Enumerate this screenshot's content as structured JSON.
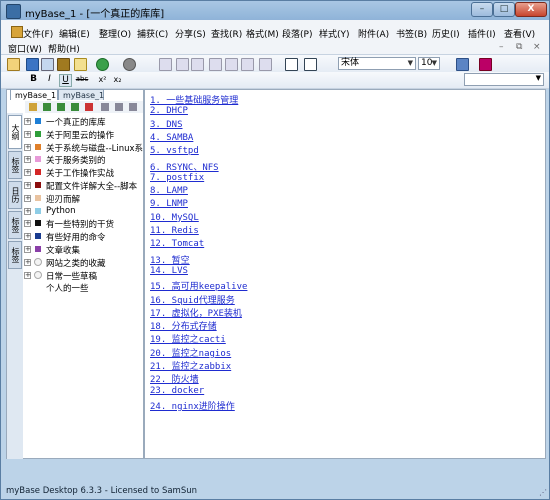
{
  "window": {
    "title": "myBase_1 - [一个真正的库库]"
  },
  "window_controls": {
    "min": "–",
    "max": "□",
    "close": "X"
  },
  "menubar": {
    "row1": [
      "文件(F)",
      "编辑(E)",
      "整理(O)",
      "捕获(C)",
      "分享(S)",
      "查找(R)",
      "格式(M)",
      "段落(P)",
      "样式(Y)",
      "附件(A)",
      "书签(B)",
      "历史(I)",
      "插件(I)",
      "查看(V)"
    ],
    "row2": [
      "窗口(W)",
      "帮助(H)"
    ],
    "mdi_controls": {
      "min": "–",
      "restore": "⧉",
      "close": "×"
    }
  },
  "toolbar": {
    "font_name": "宋体",
    "font_size": "10",
    "format_buttons": {
      "bold": "B",
      "italic": "I",
      "underline": "U",
      "strike": "abc",
      "superscript": "x²",
      "subscript": "x₂"
    }
  },
  "search": {
    "value": ""
  },
  "left_panel": {
    "tabs": [
      "myBase_1",
      "myBase_1"
    ],
    "side_tabs": [
      "大纲",
      "标签",
      "日历",
      "标签",
      "标签"
    ],
    "tree": [
      {
        "label": "一个真正的库库",
        "color": "#1e7fd6",
        "expand": "+",
        "kind": "square"
      },
      {
        "label": "关于阿里云的操作",
        "color": "#2e9e3a",
        "expand": "+",
        "kind": "square"
      },
      {
        "label": "关于系统与磁盘--Linux系",
        "color": "#e0802a",
        "expand": "+",
        "kind": "square"
      },
      {
        "label": "关于服务类别的",
        "color": "#e79ad8",
        "expand": "+",
        "kind": "square"
      },
      {
        "label": "关于工作操作实战",
        "color": "#d42626",
        "expand": "+",
        "kind": "square"
      },
      {
        "label": "配置文件详解大全--脚本",
        "color": "#8b0d0d",
        "expand": "+",
        "kind": "square"
      },
      {
        "label": "迎刃而解",
        "color": "#e9c3a0",
        "expand": "+",
        "kind": "square"
      },
      {
        "label": "Python",
        "color": "#8ecde6",
        "expand": "+",
        "kind": "square"
      },
      {
        "label": "有一些特别的干货",
        "color": "#101010",
        "expand": "+",
        "kind": "square"
      },
      {
        "label": "有些好用的命令",
        "color": "#1a3b8f",
        "expand": "+",
        "kind": "square"
      },
      {
        "label": "文章收集",
        "color": "#8a3fa8",
        "expand": "+",
        "kind": "square"
      },
      {
        "label": "网站之类的收藏",
        "color": "",
        "expand": "+",
        "kind": "circle"
      },
      {
        "label": "日常一些草稿",
        "color": "",
        "expand": "+",
        "kind": "circle"
      },
      {
        "label": "个人的一些",
        "color": "",
        "expand": "",
        "kind": "none"
      }
    ]
  },
  "content": {
    "links": [
      "1. 一些基础服务管理",
      "2. DHCP",
      "3. DNS",
      "4. SAMBA",
      "5. vsftpd",
      "6. RSYNC、NFS",
      "7. postfix",
      "8. LAMP",
      "9. LNMP",
      "10. MySQL",
      "11. Redis",
      "12. Tomcat",
      "13. 暂空",
      "14. LVS",
      "15. 高可用keepalive",
      "16. Squid代理服务",
      "17. 虚拟化，PXE装机",
      "18. 分布式存储",
      "19. 监控之cacti",
      "20. 监控之nagios",
      "21. 监控之zabbix",
      "22. 防火墙",
      "23. docker",
      "24. nginx进阶操作"
    ]
  },
  "status": {
    "text": "myBase Desktop 6.3.3 - Licensed to SamSun"
  }
}
